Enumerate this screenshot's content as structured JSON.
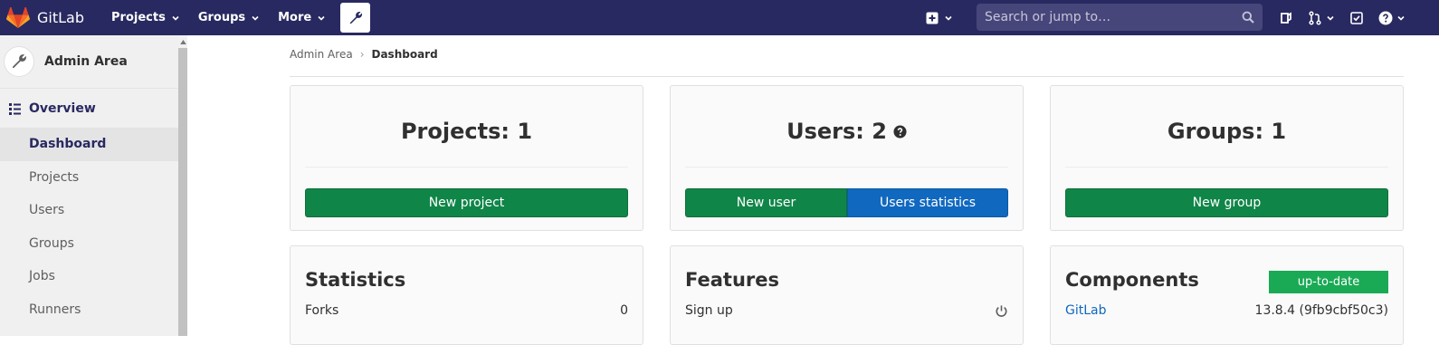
{
  "navbar": {
    "brand": "GitLab",
    "menu": [
      {
        "label": "Projects"
      },
      {
        "label": "Groups"
      },
      {
        "label": "More"
      }
    ],
    "search_placeholder": "Search or jump to…",
    "colors": {
      "background": "#292961",
      "search_bg": "#46467b"
    }
  },
  "sidebar": {
    "title": "Admin Area",
    "section": "Overview",
    "items": [
      {
        "label": "Dashboard",
        "active": true
      },
      {
        "label": "Projects",
        "active": false
      },
      {
        "label": "Users",
        "active": false
      },
      {
        "label": "Groups",
        "active": false
      },
      {
        "label": "Jobs",
        "active": false
      },
      {
        "label": "Runners",
        "active": false
      }
    ]
  },
  "breadcrumb": {
    "parent": "Admin Area",
    "current": "Dashboard"
  },
  "cards": {
    "projects": {
      "title": "Projects: 1",
      "button": "New project"
    },
    "users": {
      "title": "Users: 2",
      "button_primary": "New user",
      "button_secondary": "Users statistics"
    },
    "groups": {
      "title": "Groups: 1",
      "button": "New group"
    },
    "statistics": {
      "title": "Statistics",
      "row_label": "Forks",
      "row_value": "0"
    },
    "features": {
      "title": "Features",
      "row_label": "Sign up"
    },
    "components": {
      "title": "Components",
      "badge": "up-to-date",
      "row_label": "GitLab",
      "row_value": "13.8.4 (9fb9cbf50c3)"
    }
  },
  "colors": {
    "green": "#108548",
    "blue": "#1068bf",
    "badge_green": "#1aaa55"
  }
}
